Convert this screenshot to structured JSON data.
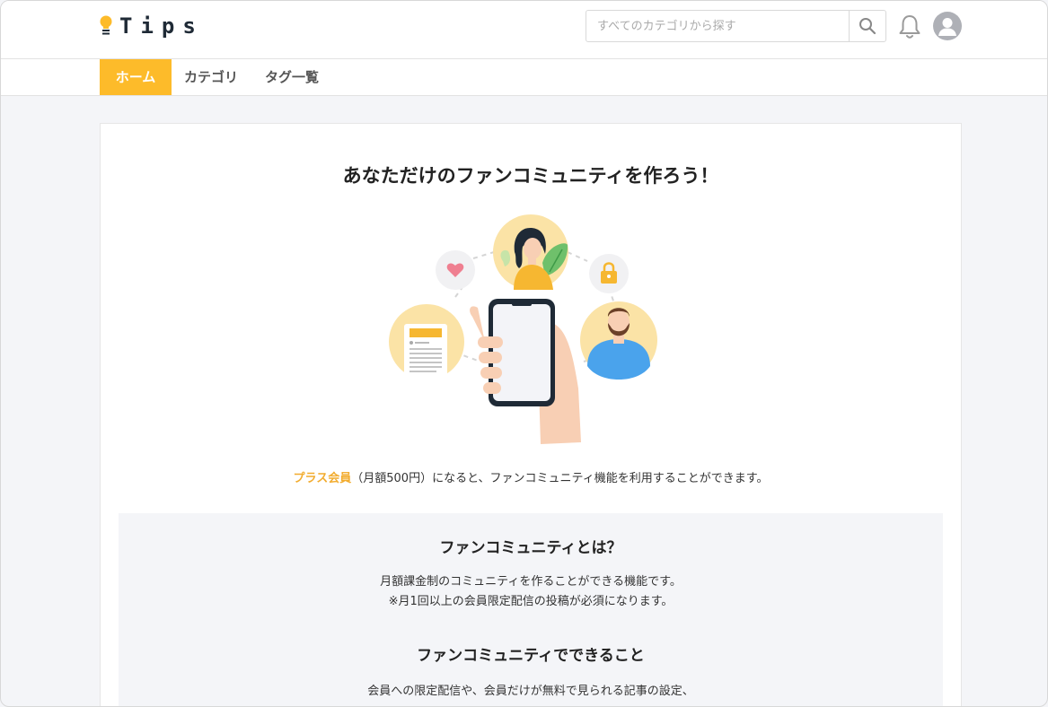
{
  "header": {
    "logo_text": "Tips",
    "search": {
      "placeholder": "すべてのカテゴリから探す",
      "value": ""
    },
    "icons": [
      "lightbulb-icon",
      "search-icon",
      "bell-icon",
      "user-avatar-icon"
    ]
  },
  "nav": {
    "items": [
      {
        "label": "ホーム",
        "active": true
      },
      {
        "label": "カテゴリ",
        "active": false
      },
      {
        "label": "タグ一覧",
        "active": false
      }
    ]
  },
  "main": {
    "title": "あなただけのファンコミュニティを作ろう！",
    "lead_highlight": "プラス会員",
    "lead_rest": "（月額500円）になると、ファンコミュニティ機能を利用することができます。",
    "sections": [
      {
        "heading": "ファンコミュニティとは？",
        "lines": [
          "月額課金制のコミュニティを作ることができる機能です。",
          "※月1回以上の会員限定配信の投稿が必須になります。"
        ]
      },
      {
        "heading": "ファンコミュニティでできること",
        "lines": [
          "会員への限定配信や、会員だけが無料で見られる記事の設定、"
        ]
      }
    ]
  },
  "colors": {
    "accent": "#fdbb2a",
    "highlight_text": "#f2ac2f",
    "page_bg": "#f4f5f8",
    "title_text": "#222222"
  }
}
